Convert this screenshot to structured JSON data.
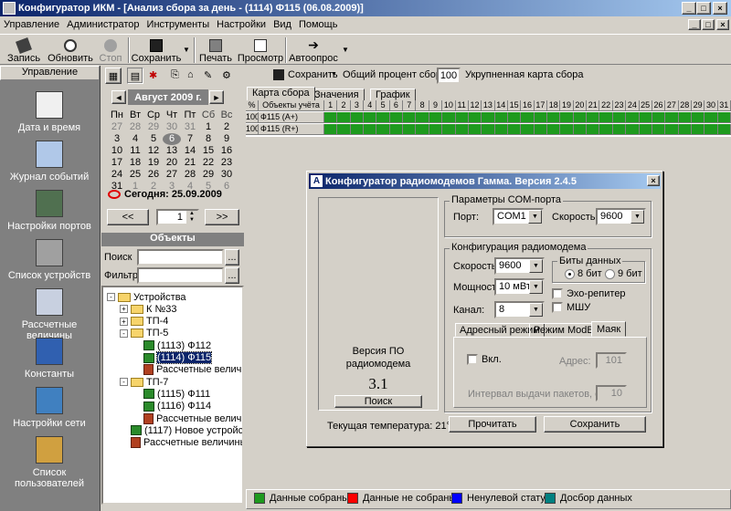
{
  "window": {
    "title": "Конфигуратор ИКМ - [Анализ сбора за день - (1114) Ф115 (06.08.2009)]"
  },
  "menu": [
    "Управление",
    "Администратор",
    "Инструменты",
    "Настройки",
    "Вид",
    "Помощь"
  ],
  "toolbar": {
    "record": "Запись",
    "refresh": "Обновить",
    "stop": "Стоп",
    "save": "Сохранить",
    "print": "Печать",
    "preview": "Просмотр",
    "autopoll": "Автоопрос"
  },
  "sidebar": {
    "header": "Управление",
    "items": [
      {
        "label": "Дата и время",
        "icon": "calendar-clock-icon"
      },
      {
        "label": "Журнал событий",
        "icon": "event-log-icon"
      },
      {
        "label": "Настройки портов",
        "icon": "port-settings-icon"
      },
      {
        "label": "Список устройств",
        "icon": "device-list-icon"
      },
      {
        "label": "Рассчетные величины",
        "icon": "calculated-values-icon"
      },
      {
        "label": "Константы",
        "icon": "constants-icon"
      },
      {
        "label": "Настройки сети",
        "icon": "network-settings-icon"
      },
      {
        "label": "Список пользователей",
        "icon": "user-list-icon"
      }
    ]
  },
  "calendar": {
    "month": "Август 2009 г.",
    "weekdays": [
      "Пн",
      "Вт",
      "Ср",
      "Чт",
      "Пт",
      "Сб",
      "Вс"
    ],
    "weeks": [
      [
        "27",
        "28",
        "29",
        "30",
        "31",
        "1",
        "2"
      ],
      [
        "3",
        "4",
        "5",
        "6",
        "7",
        "8",
        "9"
      ],
      [
        "10",
        "11",
        "12",
        "13",
        "14",
        "15",
        "16"
      ],
      [
        "17",
        "18",
        "19",
        "20",
        "21",
        "22",
        "23"
      ],
      [
        "24",
        "25",
        "26",
        "27",
        "28",
        "29",
        "30"
      ],
      [
        "31",
        "1",
        "2",
        "3",
        "4",
        "5",
        "6"
      ]
    ],
    "today": "Сегодня: 25.09.2009",
    "spin_value": "1",
    "prev": "<<",
    "next": ">>"
  },
  "objects": {
    "header": "Объекты",
    "search_label": "Поиск",
    "filter_label": "Фильтр",
    "browse": "...",
    "tree": [
      {
        "text": "Устройства",
        "type": "folder",
        "level": 0,
        "expander": "-"
      },
      {
        "text": "К №33",
        "type": "folder",
        "level": 1,
        "expander": "+"
      },
      {
        "text": "ТП-4",
        "type": "folder",
        "level": 1,
        "expander": "+"
      },
      {
        "text": "ТП-5",
        "type": "folder",
        "level": 1,
        "expander": "-"
      },
      {
        "text": "(1113) Ф112",
        "type": "dev",
        "level": 2
      },
      {
        "text": "(1114) Ф115",
        "type": "dev",
        "level": 2,
        "selected": true
      },
      {
        "text": "Рассчетные величины",
        "type": "calc",
        "level": 2
      },
      {
        "text": "ТП-7",
        "type": "folder",
        "level": 1,
        "expander": "-"
      },
      {
        "text": "(1115) Ф111",
        "type": "dev",
        "level": 2
      },
      {
        "text": "(1116) Ф114",
        "type": "dev",
        "level": 2
      },
      {
        "text": "Рассчетные величины",
        "type": "calc",
        "level": 2
      },
      {
        "text": "(1117) Новое устройство",
        "type": "dev",
        "level": 1
      },
      {
        "text": "Рассчетные величины",
        "type": "calc",
        "level": 1
      }
    ]
  },
  "right_toolbar": {
    "save": "Сохранить",
    "overall_label": "Общий процент сбора",
    "overall_value": "100",
    "map_label": "Укрупненная карта сбора"
  },
  "tabs": [
    "Карта сбора",
    "Значения",
    "График"
  ],
  "grid": {
    "col_percent": "%",
    "col_objects": "Объекты учёта",
    "days": [
      "1",
      "2",
      "3",
      "4",
      "5",
      "6",
      "7",
      "8",
      "9",
      "10",
      "11",
      "12",
      "13",
      "14",
      "15",
      "16",
      "17",
      "18",
      "19",
      "20",
      "21",
      "22",
      "23",
      "24",
      "25",
      "26",
      "27",
      "28",
      "29",
      "30",
      "31"
    ],
    "rows": [
      {
        "percent": "100",
        "name": "Ф115 (A+)"
      },
      {
        "percent": "100",
        "name": "Ф115 (R+)"
      }
    ]
  },
  "legend": [
    {
      "label": "Данные собраны",
      "color": "#1e9a1e"
    },
    {
      "label": "Данные не собраны",
      "color": "#ff0000"
    },
    {
      "label": "Ненулевой статус",
      "color": "#0000ff"
    },
    {
      "label": "Досбор данных",
      "color": "#008080"
    }
  ],
  "dialog": {
    "title": "Конфигуратор радиомодемов Гамма. Версия 2.4.5",
    "version_label": "Версия ПО радиомодема",
    "version_value": "3.1",
    "search_btn": "Поиск",
    "temp": "Текущая температура: 21°C",
    "com_group": "Параметры COM-порта",
    "port_label": "Порт:",
    "port_value": "COM1",
    "speed_label": "Скорость:",
    "speed_value": "9600",
    "modem_group": "Конфигурация радиомодема",
    "m_speed_label": "Скорость:",
    "m_speed_value": "9600",
    "power_label": "Мощность:",
    "power_value": "10 мВт",
    "channel_label": "Канал:",
    "channel_value": "8",
    "databits_group": "Биты данных",
    "bits8": "8 бит",
    "bits9": "9 бит",
    "echo": "Эхо-репитер",
    "mshu": "МШУ",
    "tabs": [
      "Адресный режим",
      "Режим ModBus",
      "Маяк"
    ],
    "enable": "Вкл.",
    "address_label": "Адрес:",
    "address_value": "101",
    "interval_label": "Интервал выдачи пакетов, сек.:",
    "interval_value": "10",
    "read_btn": "Прочитать",
    "save_btn": "Сохранить"
  }
}
